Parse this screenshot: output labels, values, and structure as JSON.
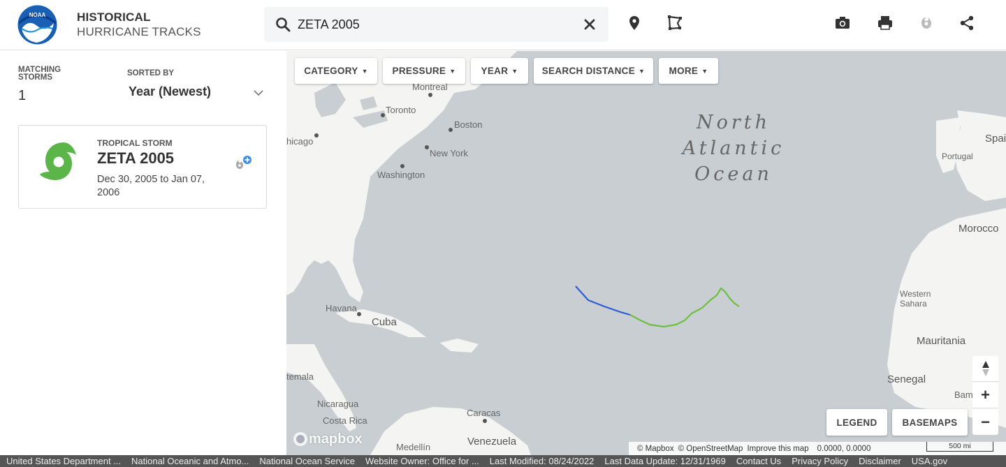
{
  "header": {
    "title_line1": "HISTORICAL",
    "title_line2": "HURRICANE TRACKS",
    "search": {
      "value": "ZETA 2005",
      "placeholder": ""
    },
    "logo_text": "NOAA"
  },
  "sidebar": {
    "matching_label": "MATCHING STORMS",
    "matching_count": "1",
    "sorted_label": "SORTED BY",
    "sorted_value": "Year (Newest)",
    "storms": [
      {
        "type": "TROPICAL STORM",
        "name": "ZETA 2005",
        "dates": "Dec 30, 2005 to Jan 07, 2006",
        "icon": "tropical-storm-icon",
        "icon_color": "#5bb548"
      }
    ]
  },
  "map": {
    "filters": [
      "CATEGORY",
      "PRESSURE",
      "YEAR",
      "SEARCH DISTANCE",
      "MORE"
    ],
    "ocean_label": "North Atlantic Ocean",
    "places": {
      "montreal": "Montreal",
      "toronto": "Toronto",
      "boston": "Boston",
      "chicago": "hicago",
      "new_york": "New York",
      "washington": "Washington",
      "havana": "Havana",
      "cuba": "Cuba",
      "guatemala": "temala",
      "nicaragua": "Nicaragua",
      "costa_rica": "Costa Rica",
      "caracas": "Caracas",
      "venezuela": "Venezuela",
      "medellin": "Medellín",
      "spain": "Spai",
      "portugal": "Portugal",
      "morocco": "Morocco",
      "western_sahara": "Western Sahara",
      "mauritania": "Mauritania",
      "senegal": "Senegal",
      "bamako": "Bama"
    },
    "legend_label": "LEGEND",
    "basemaps_label": "BASEMAPS",
    "attribution": {
      "mapbox": "© Mapbox",
      "osm": "© OpenStreetMap",
      "improve": "Improve this map",
      "coords": "0.0000, 0.0000",
      "scale": "500 mi",
      "logo": "mapbox"
    },
    "track_colors": {
      "tropical_depression": "#2b5bd6",
      "tropical_storm": "#6cbf3f"
    }
  },
  "footer": {
    "links": [
      "United States Department ...",
      "National Oceanic and Atmo...",
      "National Ocean Service",
      "Website Owner: Office for ...",
      "Last Modified: 08/24/2022",
      "Last Data Update: 12/31/1969",
      "Contact Us",
      "Privacy Policy",
      "Disclaimer",
      "USA.gov"
    ]
  }
}
